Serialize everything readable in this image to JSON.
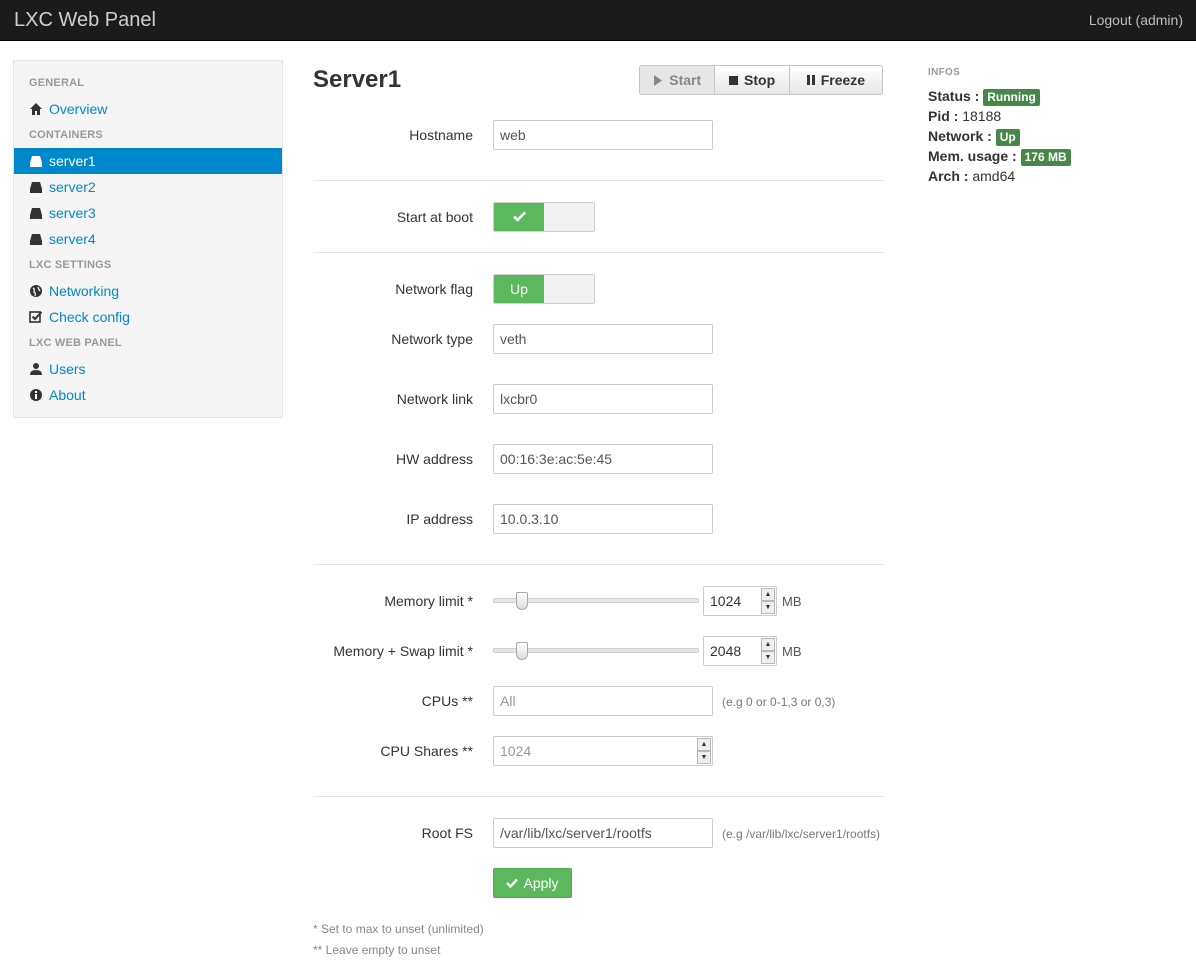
{
  "navbar": {
    "brand": "LXC Web Panel",
    "logout": "Logout (admin)"
  },
  "sidebar": {
    "sections": [
      {
        "header": "GENERAL",
        "items": [
          {
            "label": "Overview",
            "icon": "home-icon"
          }
        ]
      },
      {
        "header": "CONTAINERS",
        "items": [
          {
            "label": "server1",
            "icon": "server-icon",
            "active": true
          },
          {
            "label": "server2",
            "icon": "server-icon"
          },
          {
            "label": "server3",
            "icon": "server-icon"
          },
          {
            "label": "server4",
            "icon": "server-icon"
          }
        ]
      },
      {
        "header": "LXC SETTINGS",
        "items": [
          {
            "label": "Networking",
            "icon": "globe-icon"
          },
          {
            "label": "Check config",
            "icon": "check-icon"
          }
        ]
      },
      {
        "header": "LXC WEB PANEL",
        "items": [
          {
            "label": "Users",
            "icon": "user-icon"
          },
          {
            "label": "About",
            "icon": "info-icon"
          }
        ]
      }
    ]
  },
  "main": {
    "title": "Server1",
    "actions": {
      "start": "Start",
      "stop": "Stop",
      "freeze": "Freeze"
    },
    "form": {
      "hostname": {
        "label": "Hostname",
        "value": "web"
      },
      "start_at_boot": {
        "label": "Start at boot",
        "on": true
      },
      "network_flag": {
        "label": "Network flag",
        "value": "Up"
      },
      "network_type": {
        "label": "Network type",
        "value": "veth"
      },
      "network_link": {
        "label": "Network link",
        "value": "lxcbr0"
      },
      "hw_address": {
        "label": "HW address",
        "value": "00:16:3e:ac:5e:45"
      },
      "ip_address": {
        "label": "IP address",
        "value": "10.0.3.10"
      },
      "memory_limit": {
        "label": "Memory limit *",
        "value": "1024",
        "unit": "MB"
      },
      "memory_swap_limit": {
        "label": "Memory + Swap limit *",
        "value": "2048",
        "unit": "MB"
      },
      "cpus": {
        "label": "CPUs **",
        "placeholder": "All",
        "hint": "(e.g 0 or 0-1,3 or 0,3)"
      },
      "cpu_shares": {
        "label": "CPU Shares **",
        "placeholder": "1024"
      },
      "root_fs": {
        "label": "Root FS",
        "value": "/var/lib/lxc/server1/rootfs",
        "hint": "(e.g /var/lib/lxc/server1/rootfs)"
      },
      "apply": "Apply"
    },
    "footnotes": [
      "* Set to max to unset (unlimited)",
      "** Leave empty to unset"
    ]
  },
  "infos": {
    "header": "INFOS",
    "status_label": "Status :",
    "status": "Running",
    "pid_label": "Pid :",
    "pid": "18188",
    "network_label": "Network :",
    "network": "Up",
    "mem_label": "Mem. usage :",
    "mem": "176 MB",
    "arch_label": "Arch :",
    "arch": "amd64"
  },
  "colors": {
    "accent": "#0088cc",
    "success": "#5cb85c",
    "badge": "#468847",
    "navbar": "#1b1b1b"
  }
}
